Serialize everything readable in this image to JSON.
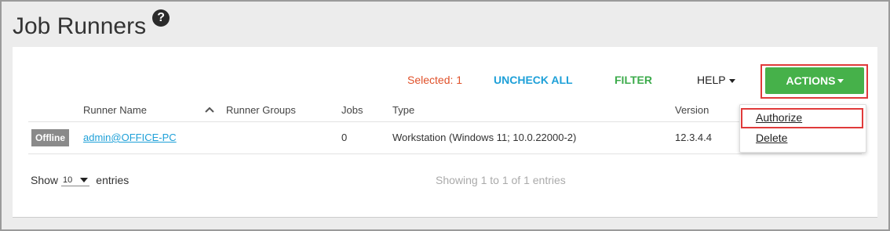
{
  "page": {
    "title": "Job Runners",
    "help_icon": "question-circle-icon"
  },
  "toolbar": {
    "selected_label": "Selected: 1",
    "uncheck_all_label": "UNCHECK ALL",
    "filter_label": "FILTER",
    "help_label": "HELP",
    "actions_label": "ACTIONS"
  },
  "actions_menu": {
    "items": [
      "Authorize",
      "Delete"
    ]
  },
  "table": {
    "columns": [
      "Runner Name",
      "Runner Groups",
      "Jobs",
      "Type",
      "Version"
    ],
    "rows": [
      {
        "status": "Offline",
        "runner_name": "admin@OFFICE-PC",
        "runner_groups": "",
        "jobs": "0",
        "type": "Workstation (Windows 11; 10.0.22000-2)",
        "version": "12.3.4.4"
      }
    ]
  },
  "footer": {
    "show_label": "Show",
    "page_size": "10",
    "entries_label": "entries",
    "showing_info": "Showing 1 to 1 of 1 entries"
  },
  "colors": {
    "accent_green": "#46b14a",
    "link_blue": "#1ea0d8",
    "selected_orange": "#e0512a",
    "highlight_red": "#e03a3a"
  }
}
